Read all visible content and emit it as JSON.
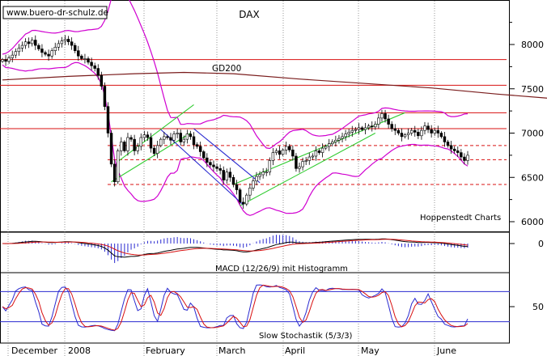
{
  "watermark": "www.buero-dr-schulz.de",
  "credit": "Hoppenstedt Charts",
  "chart_data": [
    {
      "type": "candlestick",
      "title": "DAX",
      "y_ticks": [
        6000,
        6500,
        7000,
        7500,
        8000
      ],
      "ylim": [
        5950,
        8400
      ],
      "x_labels": [
        "December",
        "2008",
        "February",
        "March",
        "April",
        "May",
        "June"
      ],
      "gd200_label": "GD200",
      "horizontal_lines": {
        "solid": [
          7830,
          7540,
          7230,
          7050
        ],
        "dashed": [
          6860,
          6700,
          6420
        ]
      },
      "gd200": [
        [
          0,
          7600
        ],
        [
          20,
          7640
        ],
        [
          40,
          7670
        ],
        [
          55,
          7685
        ],
        [
          70,
          7670
        ],
        [
          90,
          7610
        ],
        [
          110,
          7560
        ],
        [
          130,
          7510
        ],
        [
          150,
          7440
        ],
        [
          170,
          7380
        ],
        [
          190,
          7320
        ],
        [
          210,
          7290
        ]
      ],
      "close": [
        7830,
        7810,
        7850,
        7880,
        7920,
        7960,
        7990,
        8030,
        8010,
        8050,
        7990,
        7950,
        7910,
        7890,
        7870,
        7930,
        7970,
        8010,
        8040,
        8060,
        8030,
        7990,
        7930,
        7870,
        7840,
        7840,
        7800,
        7760,
        7730,
        7650,
        7530,
        7300,
        7000,
        6650,
        6450,
        6800,
        6900,
        6800,
        6950,
        6930,
        6800,
        6850,
        6950,
        6980,
        6950,
        6830,
        6770,
        6860,
        6930,
        6960,
        6950,
        6920,
        6990,
        7000,
        6900,
        6930,
        6990,
        6960,
        6870,
        6850,
        6790,
        6720,
        6670,
        6640,
        6620,
        6600,
        6580,
        6470,
        6560,
        6500,
        6420,
        6360,
        6220,
        6200,
        6300,
        6380,
        6460,
        6510,
        6530,
        6560,
        6560,
        6690,
        6780,
        6800,
        6760,
        6810,
        6850,
        6810,
        6740,
        6600,
        6620,
        6680,
        6690,
        6730,
        6740,
        6800,
        6780,
        6830,
        6850,
        6880,
        6900,
        6920,
        6940,
        6960,
        6990,
        7010,
        7030,
        7040,
        7060,
        7040,
        7060,
        7080,
        7070,
        7100,
        7170,
        7220,
        7160,
        7100,
        7050,
        7030,
        7000,
        6960,
        6980,
        7000,
        7030,
        7010,
        6970,
        7030,
        7080,
        7040,
        7000,
        7030,
        7000,
        6960,
        6900,
        6860,
        6820,
        6800,
        6780,
        6730,
        6690,
        6750
      ]
    },
    {
      "type": "line",
      "title": "MACD (12/26/9) mit Histogramm",
      "y_ticks": [
        0
      ]
    },
    {
      "type": "line",
      "title": "Slow Stochastik (5/3/3)",
      "y_ticks": [
        50
      ]
    }
  ]
}
